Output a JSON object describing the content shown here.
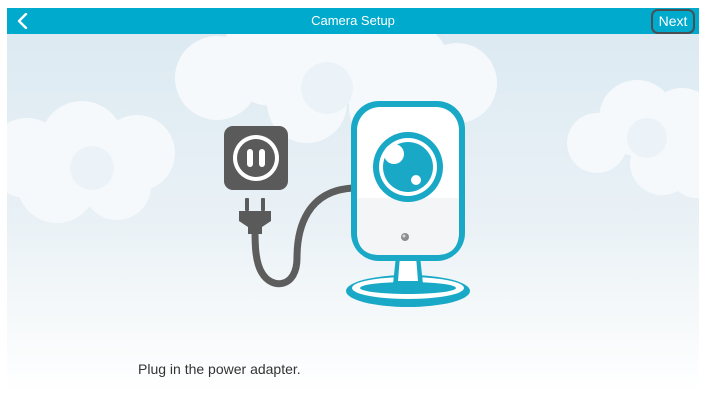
{
  "navbar": {
    "title": "Camera Setup",
    "back_icon": "chevron-left-icon",
    "next_label": "Next"
  },
  "illustration": {
    "elements": [
      "cloud-background",
      "power-outlet-icon",
      "plug-icon",
      "power-cable",
      "camera-icon"
    ]
  },
  "instruction": {
    "text": "Plug in the power adapter."
  },
  "colors": {
    "navbar": "#00aacd",
    "accent": "#19a9c7",
    "outlet": "#5a5a5a",
    "sky": "#dbe9f1"
  }
}
